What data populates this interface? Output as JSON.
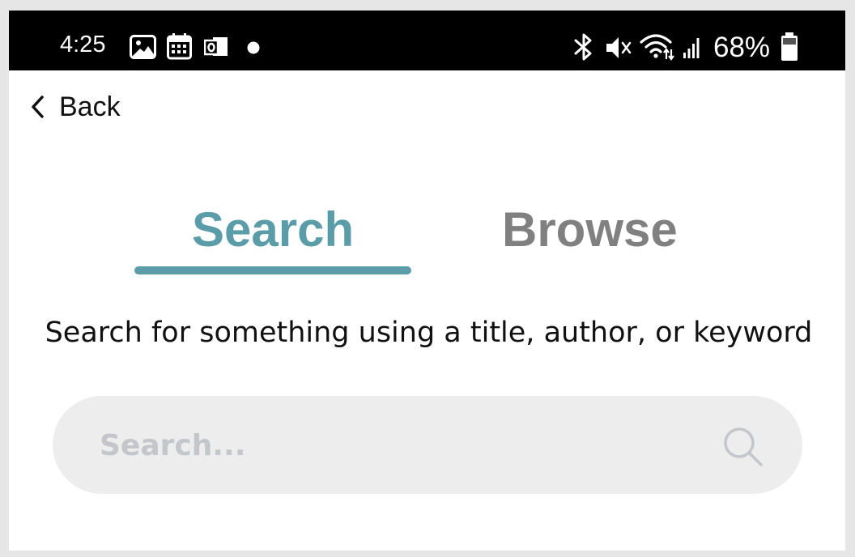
{
  "status_bar": {
    "time": "4:25",
    "battery_percent": "68%",
    "icons_left": [
      "gallery-icon",
      "calendar-icon",
      "outlook-icon",
      "notification-dot-icon"
    ],
    "icons_right": [
      "bluetooth-icon",
      "mute-icon",
      "wifi-icon",
      "signal-icon",
      "battery-icon"
    ]
  },
  "nav": {
    "back_label": "Back"
  },
  "tabs": [
    {
      "label": "Search",
      "active": true
    },
    {
      "label": "Browse",
      "active": false
    }
  ],
  "instruction": "Search for something using a title, author, or keyword",
  "search": {
    "placeholder": "Search...",
    "value": ""
  },
  "colors": {
    "accent": "#5a9ca8",
    "inactive_tab": "#808080",
    "search_bg": "#ededed",
    "placeholder": "#c3c6ca",
    "status_bar": "#000000"
  }
}
